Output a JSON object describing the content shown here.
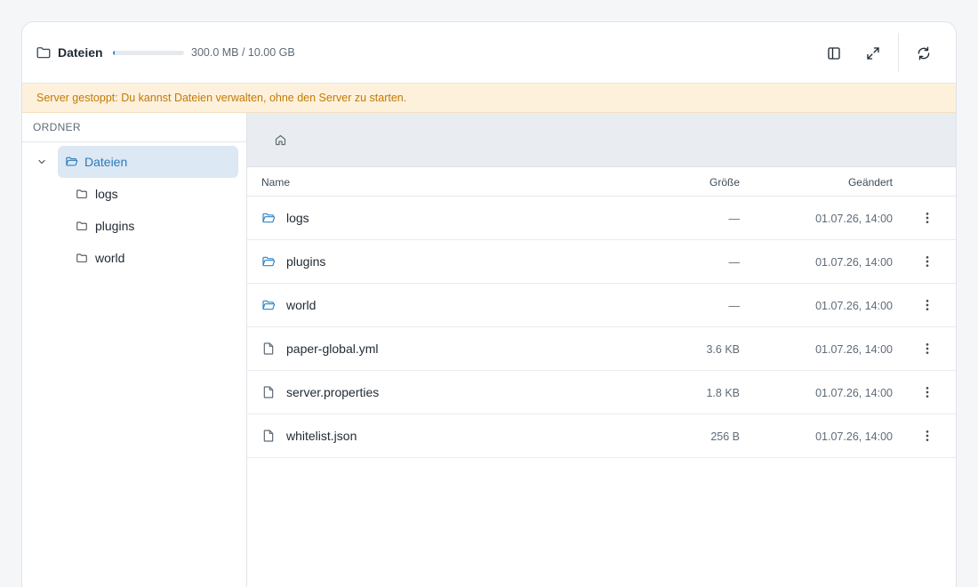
{
  "header": {
    "title": "Dateien",
    "quota_text": "300.0 MB / 10.00 GB",
    "quota_fraction": 0.03,
    "icons": [
      "folder-icon",
      "sidebar-toggle-icon",
      "expand-icon",
      "refresh-icon"
    ]
  },
  "banner": {
    "text": "Server gestoppt: Du kannst Dateien verwalten, ohne den Server zu starten."
  },
  "sidebar": {
    "heading": "ORDNER",
    "root": {
      "label": "Dateien"
    },
    "items": [
      {
        "label": "logs"
      },
      {
        "label": "plugins"
      },
      {
        "label": "world"
      }
    ]
  },
  "table": {
    "headers": {
      "name": "Name",
      "size": "Größe",
      "modified": "Geändert"
    },
    "rows": [
      {
        "name": "logs",
        "type": "folder",
        "size": "—",
        "modified": "01.07.26, 14:00"
      },
      {
        "name": "plugins",
        "type": "folder",
        "size": "—",
        "modified": "01.07.26, 14:00"
      },
      {
        "name": "world",
        "type": "folder",
        "size": "—",
        "modified": "01.07.26, 14:00"
      },
      {
        "name": "paper-global.yml",
        "type": "file",
        "size": "3.6 KB",
        "modified": "01.07.26, 14:00"
      },
      {
        "name": "server.properties",
        "type": "file",
        "size": "1.8 KB",
        "modified": "01.07.26, 14:00"
      },
      {
        "name": "whitelist.json",
        "type": "file",
        "size": "256 B",
        "modified": "01.07.26, 14:00"
      }
    ]
  },
  "colors": {
    "accent": "#2f86c6",
    "banner_bg": "#fdf1dc",
    "banner_text": "#c27a07",
    "selected_bg": "#dce8f3"
  }
}
